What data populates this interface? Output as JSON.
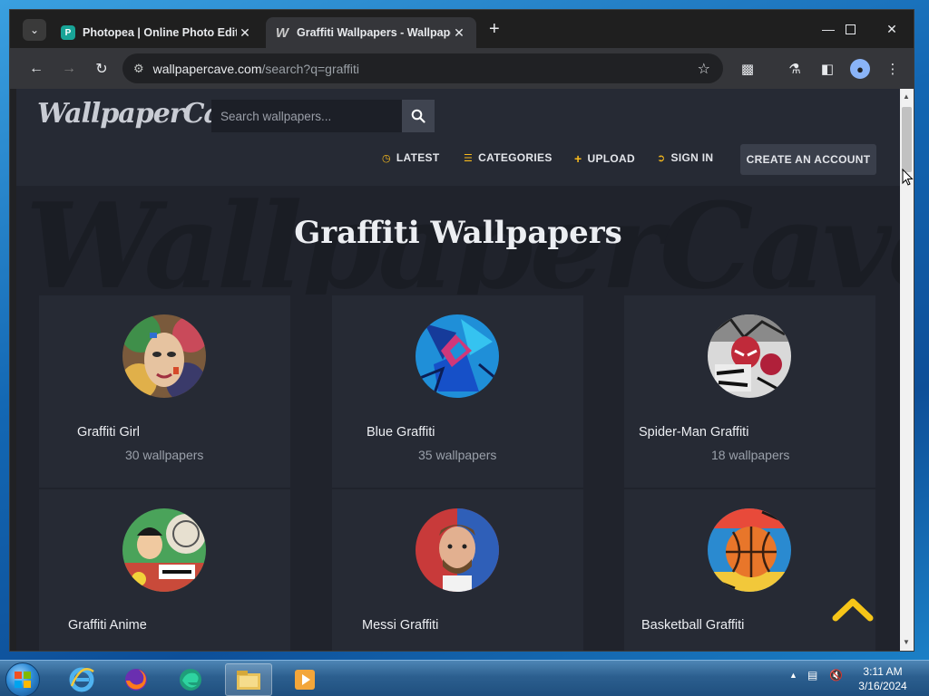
{
  "browser": {
    "tabs": [
      {
        "title": "Photopea | Online Photo Editor",
        "favicon": "photopea-icon",
        "active": false
      },
      {
        "title": "Graffiti Wallpapers - WallpaperCave",
        "favicon": "wallpapercave-icon",
        "active": true
      }
    ],
    "url": {
      "host": "wallpapercave.com",
      "path": "/search?q=graffiti"
    }
  },
  "site": {
    "logo": "WallpaperCave",
    "search_placeholder": "Search wallpapers...",
    "nav": [
      {
        "label": "LATEST",
        "icon": "clock-icon"
      },
      {
        "label": "CATEGORIES",
        "icon": "list-icon"
      },
      {
        "label": "UPLOAD",
        "icon": "plus-icon"
      },
      {
        "label": "SIGN IN",
        "icon": "sign-in-icon"
      }
    ],
    "create_account": "CREATE AN ACCOUNT",
    "watermark": "WallpaperCave"
  },
  "page": {
    "title": "Graffiti Wallpapers",
    "cards": [
      {
        "name": "Graffiti Girl",
        "count": "30 wallpapers"
      },
      {
        "name": "Blue Graffiti",
        "count": "35 wallpapers"
      },
      {
        "name": "Spider-Man Graffiti",
        "count": "18 wallpapers"
      },
      {
        "name": "Graffiti Anime",
        "count": ""
      },
      {
        "name": "Messi Graffiti",
        "count": ""
      },
      {
        "name": "Basketball Graffiti",
        "count": ""
      }
    ]
  },
  "taskbar": {
    "time": "3:11 AM",
    "date": "3/16/2024",
    "apps": [
      "internet-explorer-icon",
      "firefox-icon",
      "edge-icon",
      "file-explorer-icon",
      "media-player-icon"
    ]
  },
  "colors": {
    "page_bg": "#20232c",
    "card_bg": "#262a34",
    "accent": "#f6b91d"
  }
}
